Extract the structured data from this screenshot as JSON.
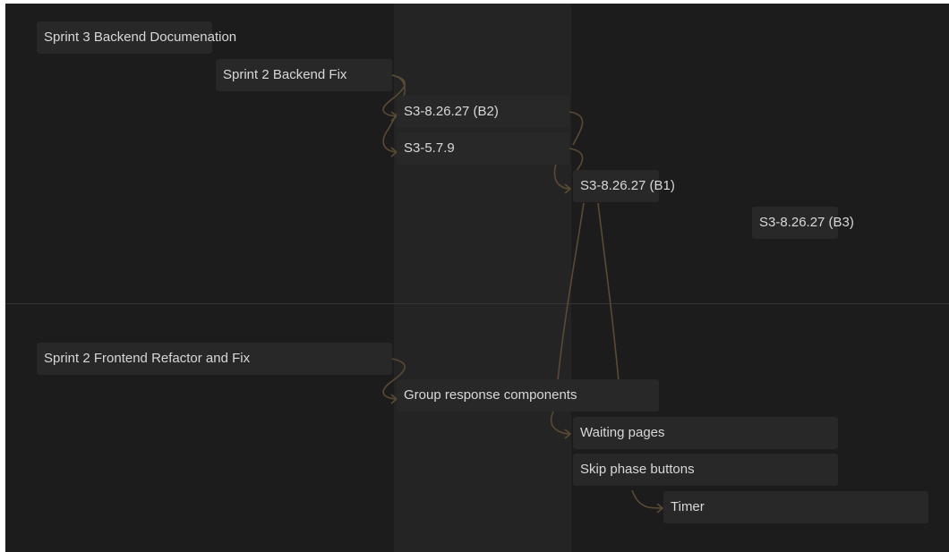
{
  "groups": {
    "backend": {
      "tasks": [
        {
          "label": "Sprint 3 Backend Documenation"
        },
        {
          "label": "Sprint 2 Backend Fix"
        },
        {
          "label": "S3-8.26.27 (B2)"
        },
        {
          "label": "S3-5.7.9"
        },
        {
          "label": "S3-8.26.27 (B1)"
        },
        {
          "label": "S3-8.26.27 (B3)"
        }
      ]
    },
    "frontend": {
      "tasks": [
        {
          "label": "Sprint 2 Frontend Refactor and Fix"
        },
        {
          "label": "Group response components"
        },
        {
          "label": "Waiting pages"
        },
        {
          "label": "Skip phase buttons"
        },
        {
          "label": "Timer"
        }
      ]
    }
  },
  "colors": {
    "background": "#1c1c1c",
    "column_highlight": "#242424",
    "task_bar": "#282828",
    "text": "#d8d8d8",
    "dependency_arrow": "#5a4a33",
    "group_divider": "#333333"
  }
}
